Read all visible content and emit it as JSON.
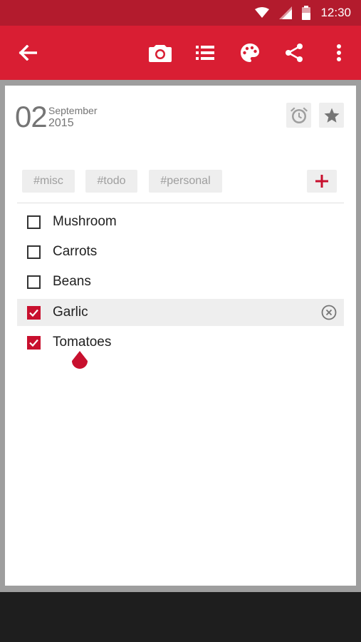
{
  "status_bar": {
    "time": "12:30",
    "icons": [
      "wifi-icon",
      "signal-icon",
      "battery-icon"
    ]
  },
  "toolbar": {
    "color": "#d91e33",
    "actions": [
      "back-arrow-icon",
      "camera-icon",
      "list-icon",
      "palette-icon",
      "share-icon",
      "more-vert-icon"
    ]
  },
  "note": {
    "day": "02",
    "month": "September",
    "year": "2015",
    "tags": [
      "#misc",
      "#todo",
      "#personal"
    ],
    "items": [
      {
        "label": "Mushroom",
        "checked": false
      },
      {
        "label": "Carrots",
        "checked": false
      },
      {
        "label": "Beans",
        "checked": false
      },
      {
        "label": "Garlic",
        "checked": true
      },
      {
        "label": "Tomatoes",
        "checked": true
      }
    ]
  },
  "accent": "#c8102e"
}
